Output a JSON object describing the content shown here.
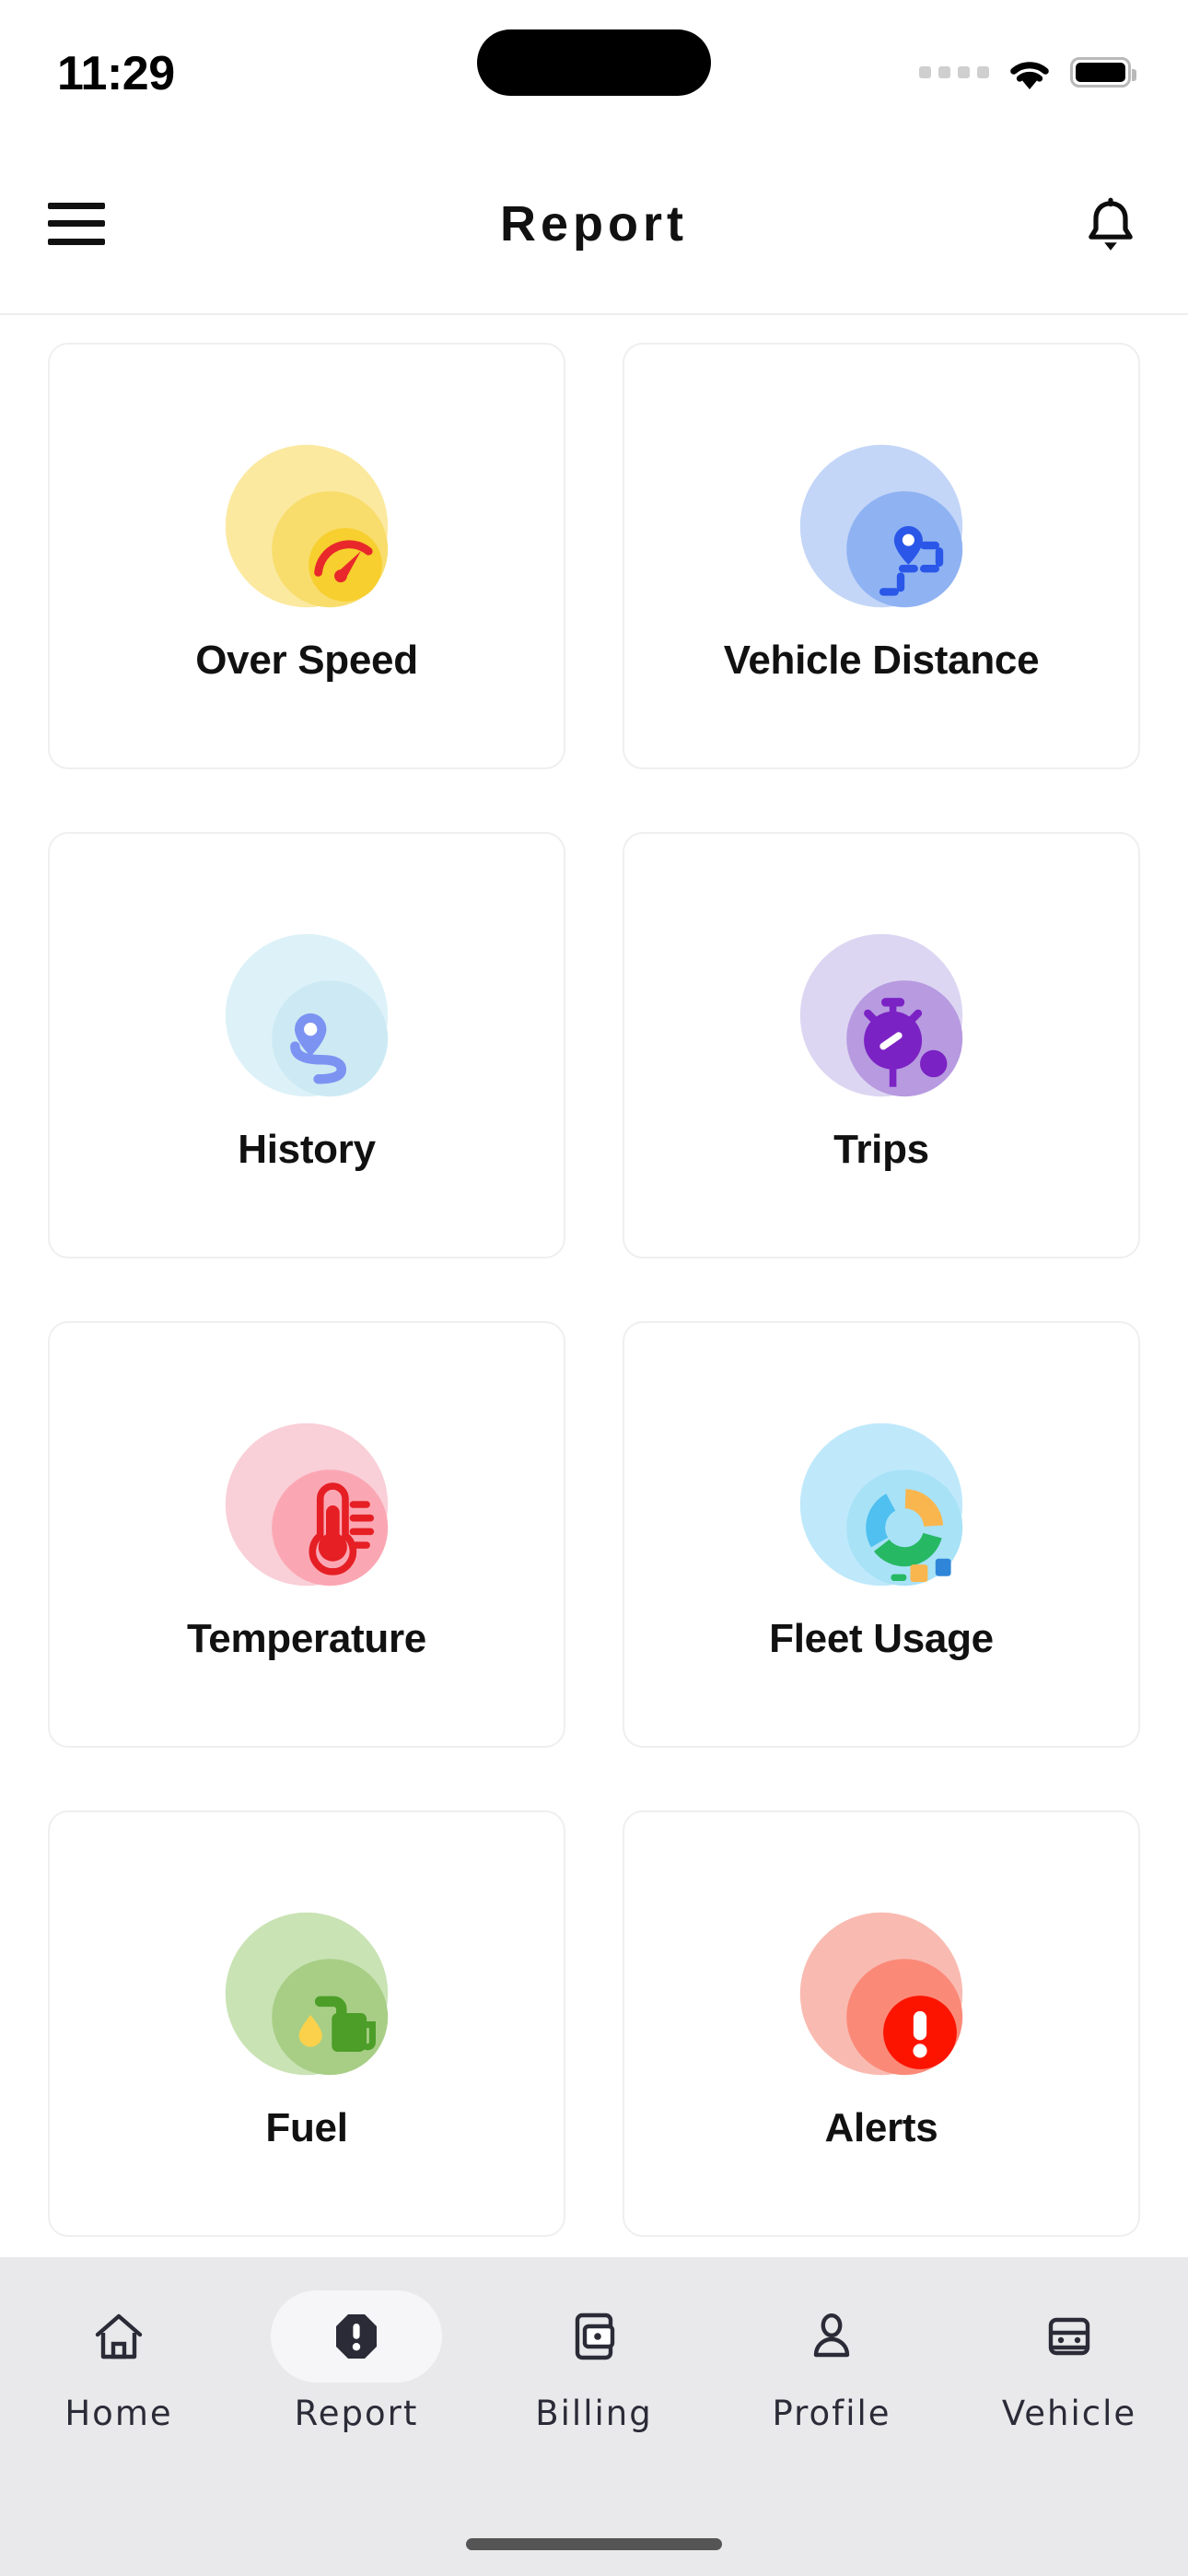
{
  "status_bar": {
    "time": "11:29",
    "signal_icon": "signal-dots-icon",
    "wifi_icon": "wifi-icon",
    "battery_icon": "battery-full-icon"
  },
  "header": {
    "menu_icon": "hamburger-menu-icon",
    "title": "Report",
    "notification_icon": "bell-icon"
  },
  "report_grid": {
    "items": [
      {
        "label": "Over Speed",
        "icon": "speedometer-icon",
        "bg_light": "#fbe9a0",
        "bg_mid": "#f8dd6c",
        "accent": "#f7cf2e",
        "accent2": "#e8282b"
      },
      {
        "label": "Vehicle Distance",
        "icon": "route-pin-icon",
        "bg_light": "#c3d6f8",
        "bg_mid": "#8fb2f2",
        "accent": "#2a57e8",
        "accent2": "#2a57e8"
      },
      {
        "label": "History",
        "icon": "location-history-icon",
        "bg_light": "#ddf2f8",
        "bg_mid": "#cdeaf4",
        "accent": "#7d93f2",
        "accent2": "#7d93f2"
      },
      {
        "label": "Trips",
        "icon": "stopwatch-icon",
        "bg_light": "#ddd6f2",
        "bg_mid": "#b79ae0",
        "accent": "#7b22c4",
        "accent2": "#7b22c4"
      },
      {
        "label": "Temperature",
        "icon": "thermometer-icon",
        "bg_light": "#f9cfd8",
        "bg_mid": "#fba7b3",
        "accent": "#e51f24",
        "accent2": "#e51f24"
      },
      {
        "label": "Fleet Usage",
        "icon": "donut-chart-icon",
        "bg_light": "#bfe9fb",
        "bg_mid": "#a8e2f7",
        "accent": "#27b864",
        "accent2": "#f9b64e"
      },
      {
        "label": "Fuel",
        "icon": "fuel-pump-icon",
        "bg_light": "#c9e3b4",
        "bg_mid": "#a8ce86",
        "accent": "#4c9e28",
        "accent2": "#fbd14b"
      },
      {
        "label": "Alerts",
        "icon": "alert-exclamation-icon",
        "bg_light": "#f9bbb1",
        "bg_mid": "#fb8978",
        "accent": "#fc1400",
        "accent2": "#ffffff"
      }
    ]
  },
  "bottom_nav": {
    "active_index": 1,
    "items": [
      {
        "label": "Home",
        "icon": "home-icon"
      },
      {
        "label": "Report",
        "icon": "alert-octagon-icon"
      },
      {
        "label": "Billing",
        "icon": "mobile-card-icon"
      },
      {
        "label": "Profile",
        "icon": "person-icon"
      },
      {
        "label": "Vehicle",
        "icon": "car-front-icon"
      }
    ]
  },
  "colors": {
    "background": "#ffffff",
    "card_border": "#efefef",
    "tabbar_background": "#e9e9eb",
    "active_pill": "#f6f6f8",
    "text_primary": "#111111"
  }
}
